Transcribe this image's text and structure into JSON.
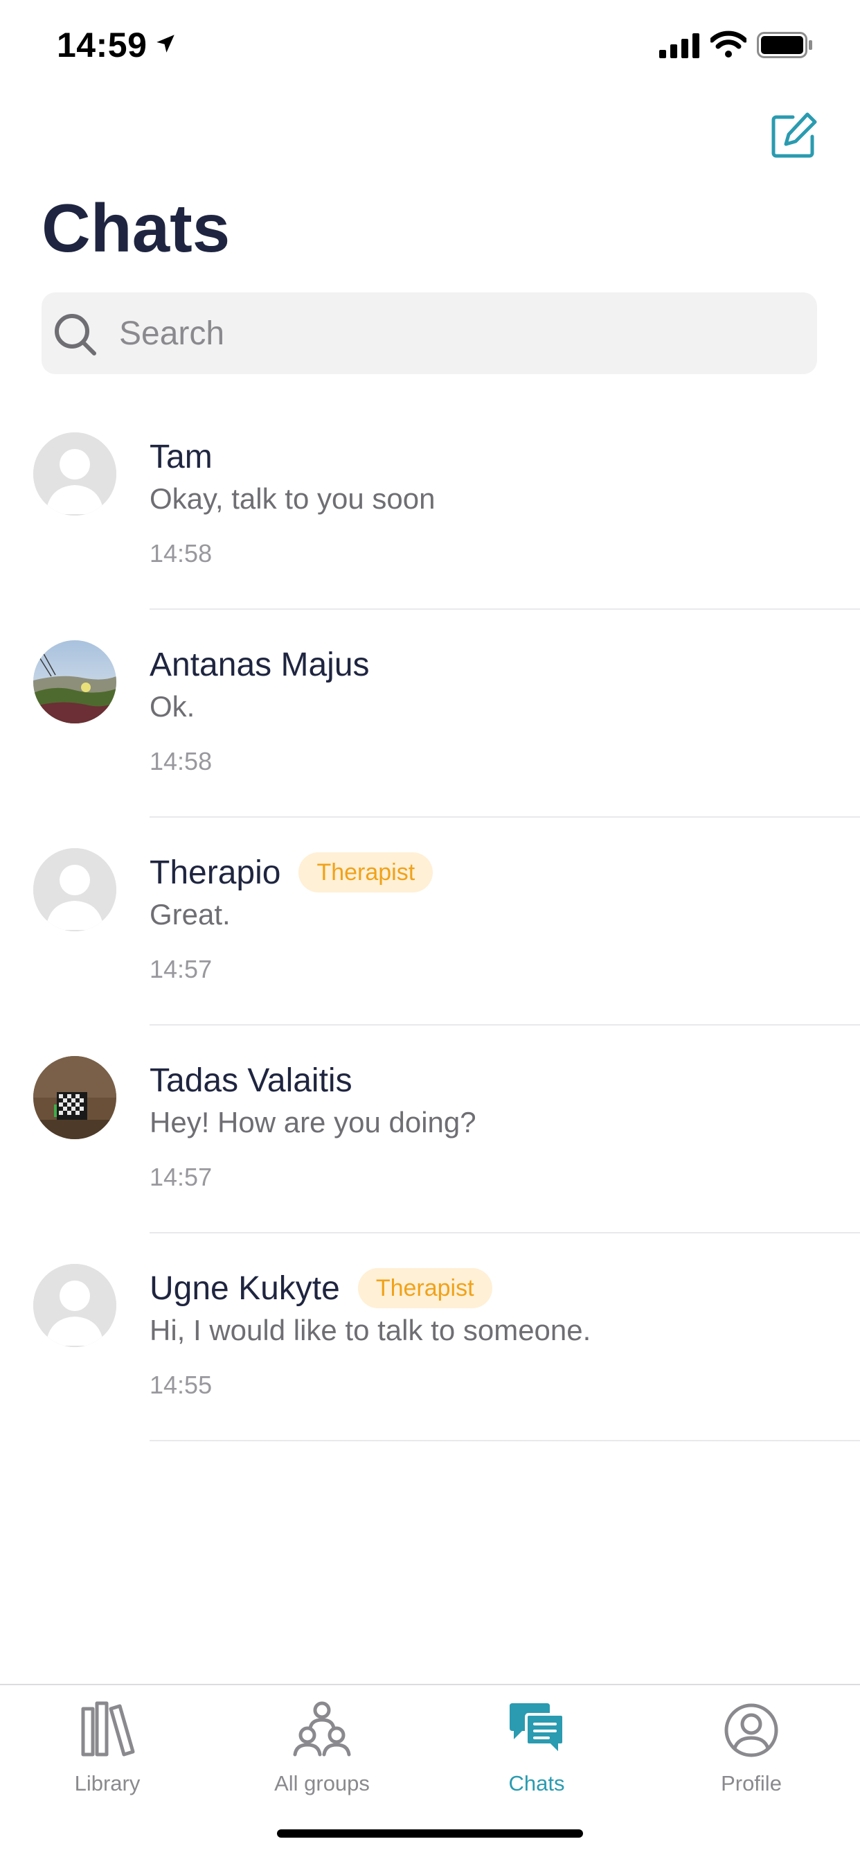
{
  "status_bar": {
    "time": "14:59",
    "icons": [
      "location-arrow-icon",
      "cellular-signal-icon",
      "wifi-icon",
      "battery-icon"
    ]
  },
  "header": {
    "title": "Chats",
    "compose_icon": "compose-icon"
  },
  "search": {
    "placeholder": "Search",
    "value": ""
  },
  "colors": {
    "accent": "#2a9bb0",
    "title": "#1f2540",
    "badge_bg": "#fff0d6",
    "badge_text": "#f0a21a"
  },
  "chats": [
    {
      "name": "Tam",
      "message": "Okay, talk to you soon",
      "time": "14:58",
      "badge": "",
      "avatar": "default-avatar"
    },
    {
      "name": "Antanas Majus",
      "message": "Ok.",
      "time": "14:58",
      "badge": "",
      "avatar": "photo-avatar-landscape"
    },
    {
      "name": "Therapio",
      "message": "Great.",
      "time": "14:57",
      "badge": "Therapist",
      "avatar": "default-avatar"
    },
    {
      "name": "Tadas Valaitis",
      "message": "Hey! How are you doing?",
      "time": "14:57",
      "badge": "",
      "avatar": "photo-avatar-room"
    },
    {
      "name": "Ugne Kukyte",
      "message": "Hi, I would like to talk to someone.",
      "time": "14:55",
      "badge": "Therapist",
      "avatar": "default-avatar"
    }
  ],
  "tabs": [
    {
      "label": "Library",
      "icon": "library-icon",
      "active": false
    },
    {
      "label": "All groups",
      "icon": "groups-icon",
      "active": false
    },
    {
      "label": "Chats",
      "icon": "chats-icon",
      "active": true
    },
    {
      "label": "Profile",
      "icon": "profile-icon",
      "active": false
    }
  ]
}
